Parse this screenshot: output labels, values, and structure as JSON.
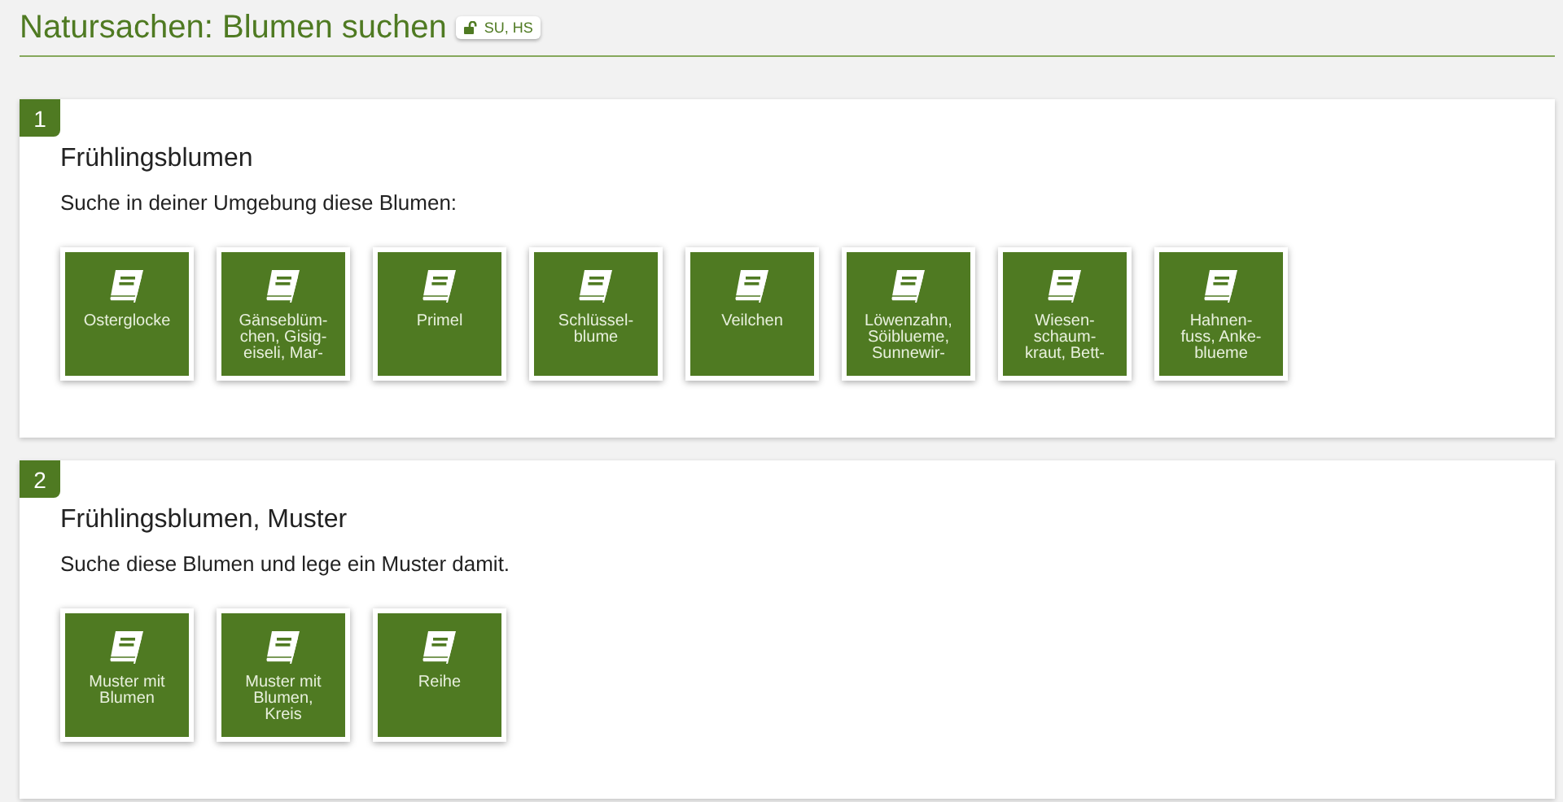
{
  "page": {
    "title": "Natursachen: Blumen suchen",
    "badge": "SU, HS"
  },
  "sections": [
    {
      "number": "1",
      "title": "Frühlingsblumen",
      "instruction": "Suche in deiner Umgebung diese Blumen:",
      "tiles": [
        {
          "lines": [
            "Osterglocke"
          ]
        },
        {
          "lines": [
            "Gänseblüm-",
            "chen, Gisig-",
            "eiseli, Mar-"
          ]
        },
        {
          "lines": [
            "Primel"
          ]
        },
        {
          "lines": [
            "Schlüssel-",
            "blume"
          ]
        },
        {
          "lines": [
            "Veilchen"
          ]
        },
        {
          "lines": [
            "Löwenzahn,",
            "Söiblueme,",
            "Sunnewir-"
          ]
        },
        {
          "lines": [
            "Wiesen-",
            "schaum-",
            "kraut, Bett-"
          ]
        },
        {
          "lines": [
            "Hahnen-",
            "fuss, Anke-",
            "blueme"
          ]
        }
      ]
    },
    {
      "number": "2",
      "title": "Frühlingsblumen, Muster",
      "instruction": "Suche diese Blumen und lege ein Muster damit.",
      "tiles": [
        {
          "lines": [
            "Muster mit",
            "Blumen"
          ]
        },
        {
          "lines": [
            "Muster mit",
            "Blumen,",
            "Kreis"
          ]
        },
        {
          "lines": [
            "Reihe"
          ]
        }
      ]
    }
  ]
}
